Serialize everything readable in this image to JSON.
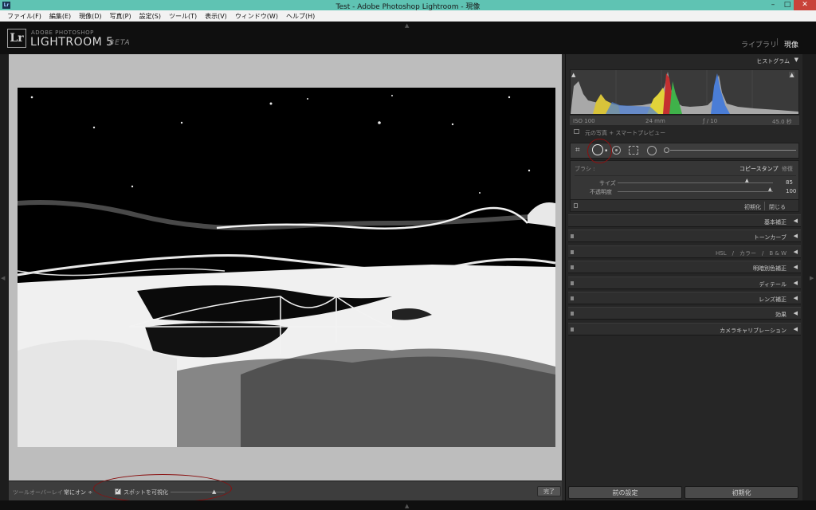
{
  "window": {
    "title": "Test - Adobe Photoshop Lightroom - 現像",
    "app_icon": "Lr",
    "controls": {
      "minimize": "–",
      "maximize": "□",
      "close": "✕"
    }
  },
  "menu": [
    "ファイル(F)",
    "編集(E)",
    "現像(D)",
    "写真(P)",
    "設定(S)",
    "ツール(T)",
    "表示(V)",
    "ウィンドウ(W)",
    "ヘルプ(H)"
  ],
  "identity": {
    "logo": "Lr",
    "brand_small": "ADOBE PHOTOSHOP",
    "brand_big": "LIGHTROOM 5",
    "beta": "BETA",
    "modules": {
      "library": "ライブラリ",
      "separator": "|",
      "develop": "現像"
    }
  },
  "histogram": {
    "title": "ヒストグラム",
    "iso": "ISO 100",
    "focal": "24 mm",
    "aperture": "ƒ / 10",
    "shutter": "45.0 秒",
    "preview": "元の写真 + スマートプレビュー"
  },
  "spot_panel": {
    "brush_label": "ブラシ :",
    "clone": "コピースタンプ",
    "heal": "修復",
    "size_label": "サイズ",
    "size_value": "85",
    "opacity_label": "不透明度",
    "opacity_value": "100",
    "reset": "初期化",
    "close": "閉じる"
  },
  "panels": [
    {
      "label": "基本補正"
    },
    {
      "label": "トーンカーブ"
    },
    {
      "label": "HSL　/　カラー　/　B & W"
    },
    {
      "label": "明暗別色補正"
    },
    {
      "label": "ディテール"
    },
    {
      "label": "レンズ補正"
    },
    {
      "label": "効果"
    },
    {
      "label": "カメラキャリブレーション"
    }
  ],
  "toolbar": {
    "overlay_label": "ツールオーバーレイ :",
    "overlay_value": "常にオン ÷",
    "visualize_spots": "スポットを可視化",
    "done": "完了"
  },
  "right_buttons": {
    "previous": "前の設定",
    "reset": "初期化"
  },
  "colors": {
    "title_bar": "#5fc3b3",
    "annotation": "#8a1010",
    "canvas": "#bdbdbd"
  }
}
